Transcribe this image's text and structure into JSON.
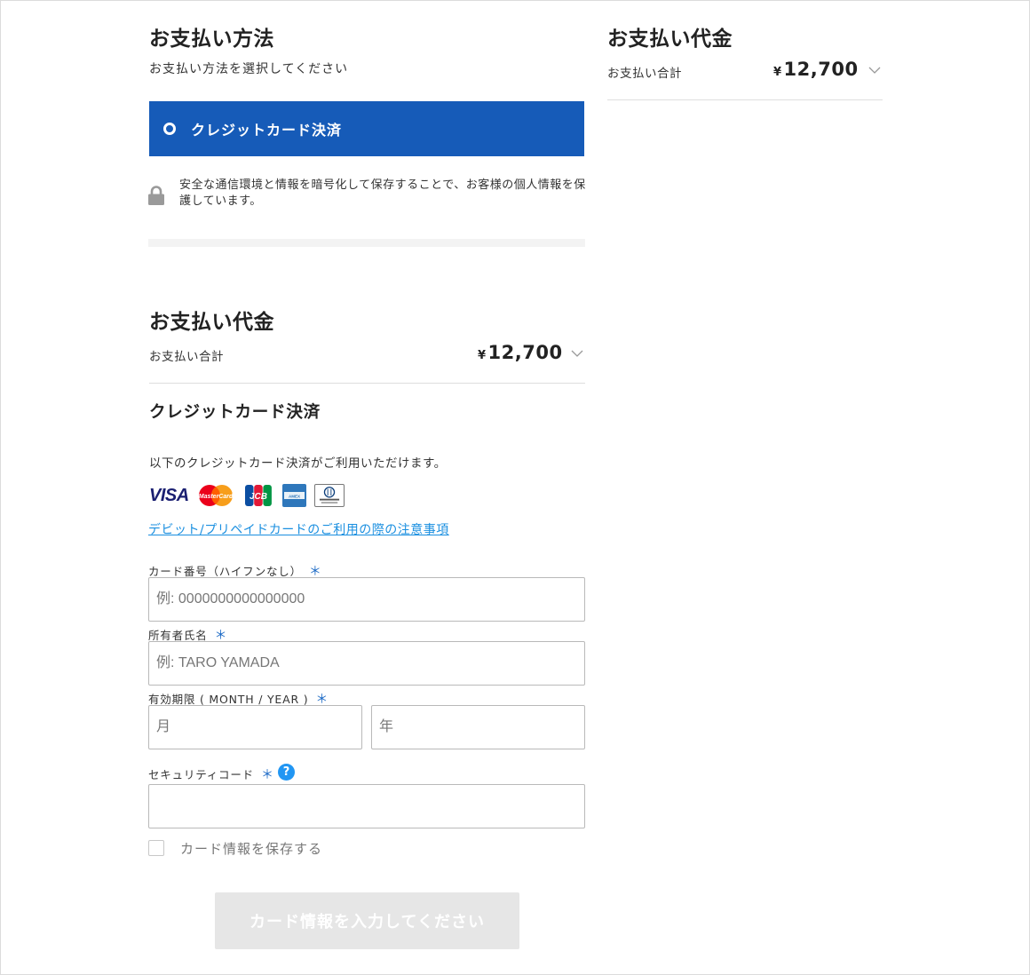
{
  "payment_method": {
    "title": "お支払い方法",
    "subtitle": "お支払い方法を選択してください",
    "selected_method": "クレジットカード決済",
    "security_note": "安全な通信環境と情報を暗号化して保存することで、お客様の個人情報を保護しています。"
  },
  "summary_left": {
    "title": "お支払い代金",
    "total_label": "お支払い合計",
    "currency": "¥",
    "total_amount": "12,700"
  },
  "summary_right": {
    "title": "お支払い代金",
    "total_label": "お支払い合計",
    "currency": "¥",
    "total_amount": "12,700"
  },
  "credit_card": {
    "title": "クレジットカード決済",
    "description": "以下のクレジットカード決済がご利用いただけます。",
    "brands": [
      "VISA",
      "MasterCard",
      "JCB",
      "AMERICAN EXPRESS",
      "Diners Club INTERNATIONAL"
    ],
    "notice_link": "デビット/プリペイドカードのご利用の際の注意事項",
    "required_mark": "＊",
    "card_number": {
      "label": "カード番号（ハイフンなし）",
      "placeholder": "例: 0000000000000000"
    },
    "holder_name": {
      "label": "所有者氏名",
      "placeholder": "例: TARO YAMADA"
    },
    "expiry": {
      "label": "有効期限 ( MONTH / YEAR )",
      "month_placeholder": "月",
      "year_placeholder": "年"
    },
    "security_code": {
      "label": "セキュリティコード",
      "help": "?"
    },
    "save_card_label": "カード情報を保存する",
    "submit_label": "カード情報を入力してください"
  },
  "colors": {
    "primary_blue": "#165bb8",
    "link_blue": "#1a8fe0",
    "required_blue": "#1e6bc6",
    "help_blue": "#2196f3",
    "disabled_button": "#e6e6e6"
  }
}
